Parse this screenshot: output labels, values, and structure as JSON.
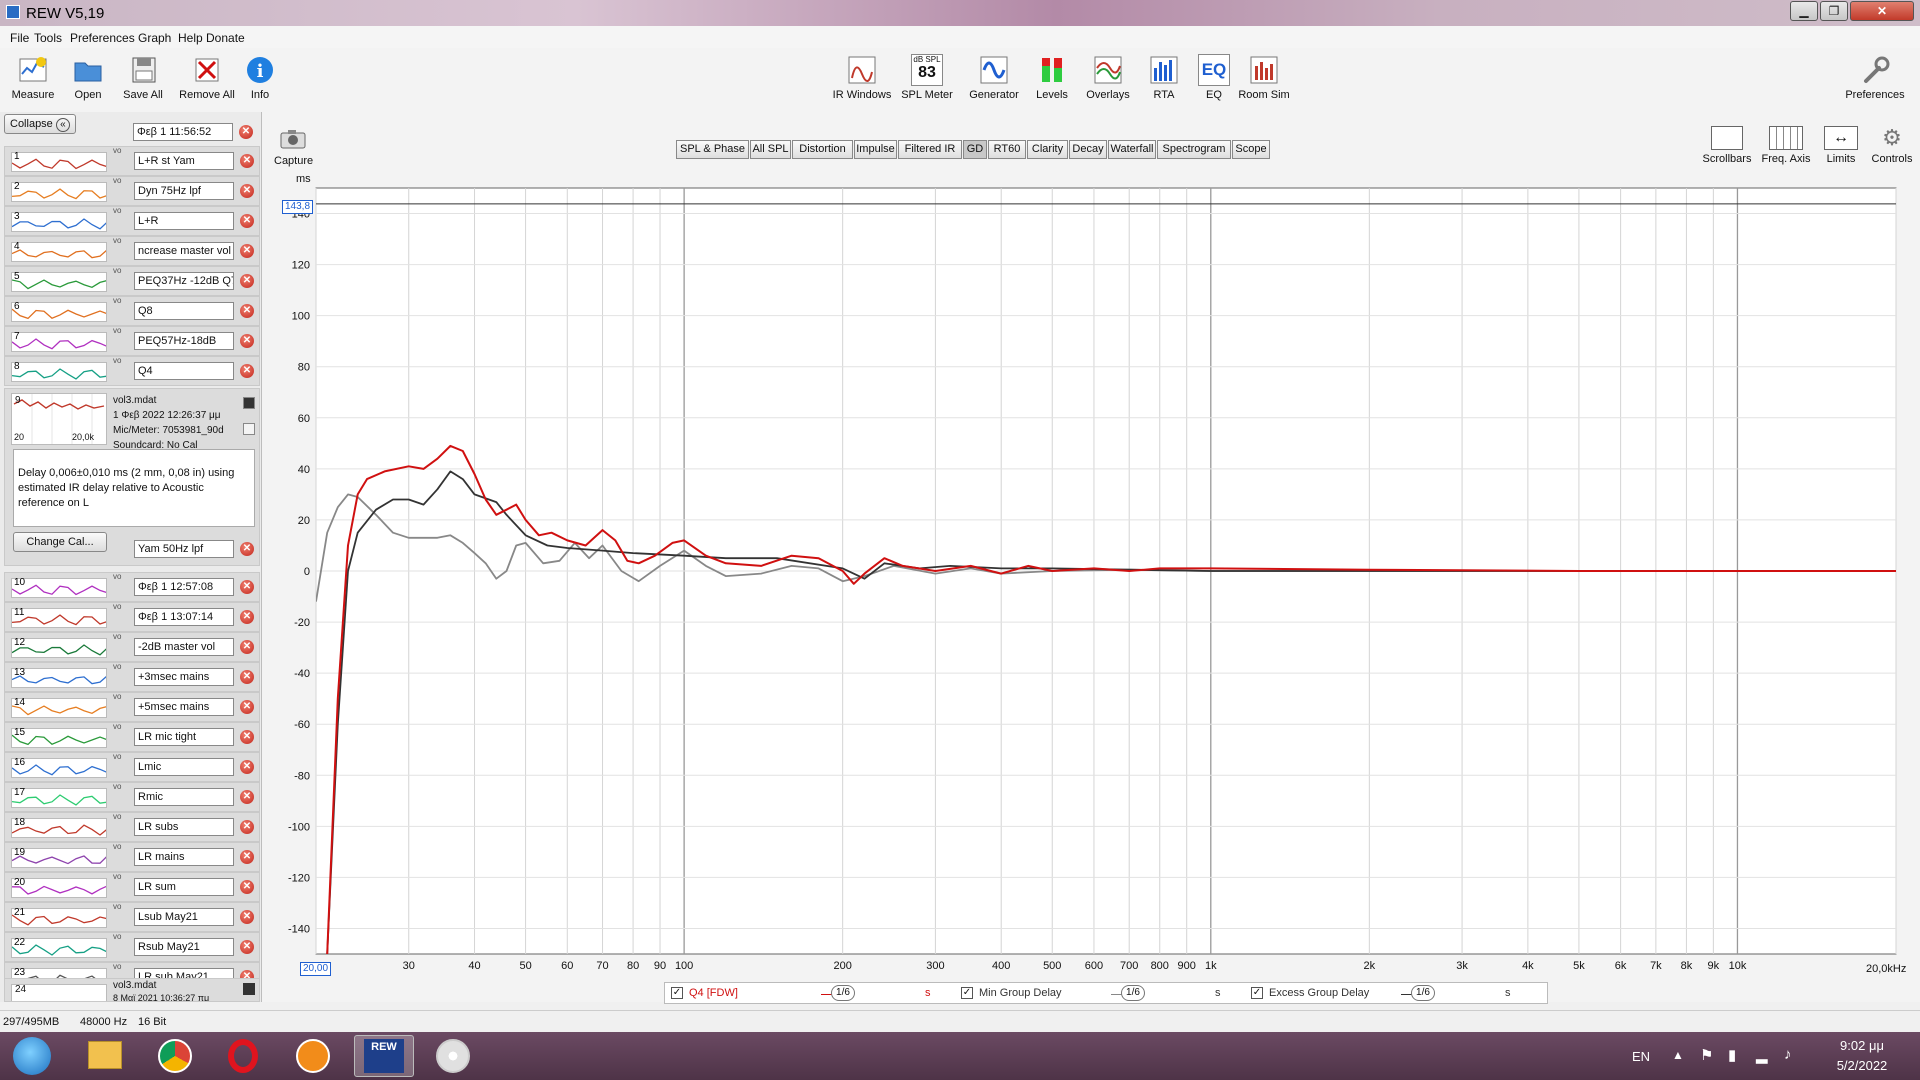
{
  "window": {
    "title": "REW V5,19"
  },
  "menu": [
    "File",
    "Tools",
    "Preferences",
    "Graph",
    "Help",
    "Donate"
  ],
  "toolbar_left": [
    {
      "label": "Measure",
      "icon": "measure-icon"
    },
    {
      "label": "Open",
      "icon": "folder-icon"
    },
    {
      "label": "Save All",
      "icon": "save-icon"
    },
    {
      "label": "Remove All",
      "icon": "remove-icon"
    },
    {
      "label": "Info",
      "icon": "info-icon"
    }
  ],
  "toolbar_center": [
    {
      "label": "IR Windows",
      "icon": "ir-windows-icon"
    },
    {
      "label": "SPL Meter",
      "icon": "spl-meter-icon",
      "badge_top": "dB SPL",
      "badge_value": "83"
    },
    {
      "label": "Generator",
      "icon": "generator-icon"
    },
    {
      "label": "Levels",
      "icon": "levels-icon"
    },
    {
      "label": "Overlays",
      "icon": "overlays-icon"
    },
    {
      "label": "RTA",
      "icon": "rta-icon"
    },
    {
      "label": "EQ",
      "icon": "eq-icon",
      "badge_value": "EQ"
    },
    {
      "label": "Room Sim",
      "icon": "room-sim-icon"
    }
  ],
  "toolbar_right": {
    "label": "Preferences",
    "icon": "wrench-icon"
  },
  "panel": {
    "collapse_label": "Collapse",
    "top_name": "Φεβ 1 11:56:52",
    "measurements": [
      {
        "n": "1",
        "name": "L+R st Yam",
        "color": "#c0392b"
      },
      {
        "n": "2",
        "name": "Dyn 75Hz lpf",
        "color": "#e67e22"
      },
      {
        "n": "3",
        "name": "L+R",
        "color": "#2e6fd0"
      },
      {
        "n": "4",
        "name": "ncrease master vol",
        "color": "#e07020"
      },
      {
        "n": "5",
        "name": "PEQ37Hz -12dB Q7",
        "color": "#2a9a3a"
      },
      {
        "n": "6",
        "name": "Q8",
        "color": "#e07020"
      },
      {
        "n": "7",
        "name": "PEQ57Hz-18dB",
        "color": "#b030c0"
      },
      {
        "n": "8",
        "name": "Q4",
        "color": "#16a085"
      }
    ],
    "selected": {
      "n": "9",
      "file": "vol3.mdat",
      "date": "1 Φεβ 2022 12:26:37 μμ",
      "mic": "Mic/Meter: 7053981_90d",
      "soundcard": "Soundcard: No Cal",
      "axis_min": "20",
      "axis_max": "20,0k",
      "note": "Delay 0,006±0,010 ms (2 mm, 0,08 in) using estimated IR delay relative to Acoustic reference on  L",
      "change_cal": "Change Cal...",
      "name": "Yam 50Hz lpf"
    },
    "measurements2": [
      {
        "n": "10",
        "name": "Φεβ 1 12:57:08",
        "color": "#b030c0"
      },
      {
        "n": "11",
        "name": "Φεβ 1 13:07:14",
        "color": "#c0392b"
      },
      {
        "n": "12",
        "name": "-2dB master vol",
        "color": "#1a7a3a"
      },
      {
        "n": "13",
        "name": "+3msec mains",
        "color": "#2e6fd0"
      },
      {
        "n": "14",
        "name": "+5msec mains",
        "color": "#e67e22"
      },
      {
        "n": "15",
        "name": "LR mic tight",
        "color": "#2a9a3a"
      },
      {
        "n": "16",
        "name": "Lmic",
        "color": "#2e6fd0"
      },
      {
        "n": "17",
        "name": "Rmic",
        "color": "#2ecc71"
      },
      {
        "n": "18",
        "name": "LR subs",
        "color": "#c0392b"
      },
      {
        "n": "19",
        "name": "LR mains",
        "color": "#8e44ad"
      },
      {
        "n": "20",
        "name": "LR sum",
        "color": "#b030c0"
      },
      {
        "n": "21",
        "name": "Lsub May21",
        "color": "#c0392b"
      },
      {
        "n": "22",
        "name": "Rsub May21",
        "color": "#16a085"
      },
      {
        "n": "23",
        "name": "LR sub May21",
        "color": "#555555"
      }
    ],
    "last": {
      "n": "24",
      "file": "vol3.mdat",
      "date": "8 Μαϊ 2021 10:36:27 πμ"
    }
  },
  "graph": {
    "capture_label": "Capture",
    "tabs": [
      "SPL & Phase",
      "All SPL",
      "Distortion",
      "Impulse",
      "Filtered IR",
      "GD",
      "RT60",
      "Clarity",
      "Decay",
      "Waterfall",
      "Spectrogram",
      "Scope"
    ],
    "active_tab": "GD",
    "right_controls": [
      {
        "label": "Scrollbars",
        "icon": "scrollbars-icon"
      },
      {
        "label": "Freq. Axis",
        "icon": "freq-axis-icon"
      },
      {
        "label": "Limits",
        "icon": "limits-icon"
      },
      {
        "label": "Controls",
        "icon": "controls-icon"
      }
    ],
    "unit": "ms",
    "cursor_value": "143,8",
    "x_start_label": "20,00",
    "x_end_label": "20,0kHz"
  },
  "chart_data": {
    "type": "line",
    "ylabel": "ms",
    "xscale": "log",
    "xlim": [
      20,
      20000
    ],
    "ylim": [
      -150,
      150
    ],
    "yticks": [
      140,
      120,
      100,
      80,
      60,
      40,
      20,
      0,
      -20,
      -40,
      -60,
      -80,
      -100,
      -120,
      -140
    ],
    "xtick_labels": [
      {
        "v": 30,
        "t": "30"
      },
      {
        "v": 40,
        "t": "40"
      },
      {
        "v": 50,
        "t": "50"
      },
      {
        "v": 60,
        "t": "60"
      },
      {
        "v": 70,
        "t": "70"
      },
      {
        "v": 80,
        "t": "80"
      },
      {
        "v": 90,
        "t": "90"
      },
      {
        "v": 100,
        "t": "100"
      },
      {
        "v": 200,
        "t": "200"
      },
      {
        "v": 300,
        "t": "300"
      },
      {
        "v": 400,
        "t": "400"
      },
      {
        "v": 500,
        "t": "500"
      },
      {
        "v": 600,
        "t": "600"
      },
      {
        "v": 700,
        "t": "700"
      },
      {
        "v": 800,
        "t": "800"
      },
      {
        "v": 900,
        "t": "900"
      },
      {
        "v": 1000,
        "t": "1k"
      },
      {
        "v": 2000,
        "t": "2k"
      },
      {
        "v": 3000,
        "t": "3k"
      },
      {
        "v": 4000,
        "t": "4k"
      },
      {
        "v": 5000,
        "t": "5k"
      },
      {
        "v": 6000,
        "t": "6k"
      },
      {
        "v": 7000,
        "t": "7k"
      },
      {
        "v": 8000,
        "t": "8k"
      },
      {
        "v": 9000,
        "t": "9k"
      },
      {
        "v": 10000,
        "t": "10k"
      }
    ],
    "cursor_line": 143.8,
    "grid": true,
    "series": [
      {
        "name": "Q4 [FDW]",
        "color": "#d01010",
        "smoothing": "1/6",
        "unit": "s",
        "points": [
          [
            21,
            -150
          ],
          [
            22,
            -50
          ],
          [
            23,
            10
          ],
          [
            24,
            30
          ],
          [
            25,
            36
          ],
          [
            27,
            39
          ],
          [
            30,
            41
          ],
          [
            32,
            40
          ],
          [
            34,
            44
          ],
          [
            36,
            49
          ],
          [
            38,
            47
          ],
          [
            40,
            38
          ],
          [
            42,
            28
          ],
          [
            44,
            22
          ],
          [
            46,
            24
          ],
          [
            48,
            26
          ],
          [
            50,
            20
          ],
          [
            53,
            14
          ],
          [
            56,
            15
          ],
          [
            60,
            12
          ],
          [
            65,
            10
          ],
          [
            70,
            16
          ],
          [
            74,
            12
          ],
          [
            78,
            4
          ],
          [
            82,
            3
          ],
          [
            88,
            6
          ],
          [
            95,
            11
          ],
          [
            100,
            12
          ],
          [
            110,
            6
          ],
          [
            120,
            3
          ],
          [
            140,
            2
          ],
          [
            160,
            6
          ],
          [
            180,
            5
          ],
          [
            200,
            0
          ],
          [
            210,
            -5
          ],
          [
            220,
            -1
          ],
          [
            240,
            5
          ],
          [
            260,
            2
          ],
          [
            300,
            0
          ],
          [
            350,
            2
          ],
          [
            400,
            -1
          ],
          [
            450,
            2
          ],
          [
            500,
            0
          ],
          [
            600,
            1
          ],
          [
            700,
            0
          ],
          [
            800,
            1
          ],
          [
            1000,
            1
          ],
          [
            2000,
            0.5
          ],
          [
            5000,
            0
          ],
          [
            20000,
            0
          ]
        ]
      },
      {
        "name": "Min Group Delay",
        "color": "#888888",
        "smoothing": "1/6",
        "unit": "s",
        "points": [
          [
            20,
            -12
          ],
          [
            21,
            15
          ],
          [
            22,
            25
          ],
          [
            23,
            30
          ],
          [
            24,
            29
          ],
          [
            26,
            22
          ],
          [
            28,
            15
          ],
          [
            30,
            13
          ],
          [
            34,
            13
          ],
          [
            36,
            14
          ],
          [
            38,
            11
          ],
          [
            40,
            7
          ],
          [
            42,
            3
          ],
          [
            44,
            -3
          ],
          [
            46,
            0
          ],
          [
            48,
            10
          ],
          [
            50,
            11
          ],
          [
            54,
            3
          ],
          [
            58,
            4
          ],
          [
            62,
            11
          ],
          [
            66,
            5
          ],
          [
            70,
            10
          ],
          [
            76,
            0
          ],
          [
            82,
            -4
          ],
          [
            90,
            2
          ],
          [
            100,
            8
          ],
          [
            110,
            2
          ],
          [
            120,
            -2
          ],
          [
            140,
            -1
          ],
          [
            160,
            2
          ],
          [
            180,
            1
          ],
          [
            200,
            -4
          ],
          [
            220,
            -2
          ],
          [
            250,
            2
          ],
          [
            300,
            -1
          ],
          [
            350,
            1
          ],
          [
            400,
            -1
          ],
          [
            500,
            0
          ],
          [
            700,
            0.5
          ],
          [
            1000,
            0
          ],
          [
            20000,
            0
          ]
        ]
      },
      {
        "name": "Excess Group Delay",
        "color": "#333333",
        "smoothing": "1/6",
        "unit": "s",
        "points": [
          [
            21,
            -150
          ],
          [
            22,
            -60
          ],
          [
            23,
            0
          ],
          [
            24,
            15
          ],
          [
            26,
            24
          ],
          [
            28,
            28
          ],
          [
            30,
            28
          ],
          [
            32,
            26
          ],
          [
            34,
            32
          ],
          [
            36,
            39
          ],
          [
            38,
            36
          ],
          [
            40,
            30
          ],
          [
            44,
            27
          ],
          [
            46,
            22
          ],
          [
            50,
            14
          ],
          [
            55,
            10
          ],
          [
            60,
            9
          ],
          [
            70,
            8
          ],
          [
            80,
            7
          ],
          [
            100,
            6
          ],
          [
            120,
            5
          ],
          [
            150,
            5
          ],
          [
            200,
            1
          ],
          [
            220,
            -3
          ],
          [
            240,
            3
          ],
          [
            280,
            1
          ],
          [
            320,
            2
          ],
          [
            400,
            1
          ],
          [
            500,
            1
          ],
          [
            700,
            0.5
          ],
          [
            1000,
            0
          ],
          [
            20000,
            0
          ]
        ]
      }
    ]
  },
  "legend": [
    {
      "label": "Q4 [FDW]",
      "checked": true,
      "smoothing": "1/6",
      "unit": "s"
    },
    {
      "label": "Min Group Delay",
      "checked": true,
      "smoothing": "1/6",
      "unit": "s"
    },
    {
      "label": "Excess Group Delay",
      "checked": true,
      "smoothing": "1/6",
      "unit": "s"
    }
  ],
  "status": {
    "memory": "297/495MB",
    "rate": "48000 Hz",
    "bits": "16 Bit"
  },
  "taskbar": {
    "lang": "EN",
    "time": "9:02 μμ",
    "date": "5/2/2022"
  }
}
